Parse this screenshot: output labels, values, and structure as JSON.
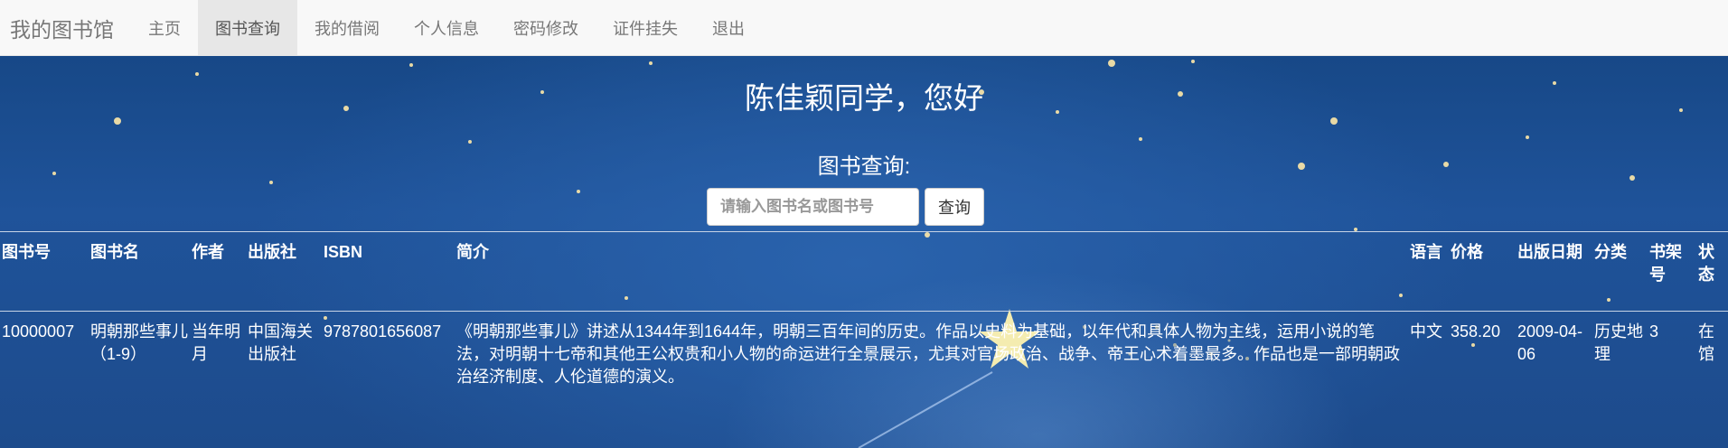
{
  "navbar": {
    "brand": "我的图书馆",
    "items": [
      {
        "label": "主页",
        "active": false
      },
      {
        "label": "图书查询",
        "active": true
      },
      {
        "label": "我的借阅",
        "active": false
      },
      {
        "label": "个人信息",
        "active": false
      },
      {
        "label": "密码修改",
        "active": false
      },
      {
        "label": "证件挂失",
        "active": false
      },
      {
        "label": "退出",
        "active": false
      }
    ]
  },
  "greeting": "陈佳颖同学，您好",
  "search": {
    "label": "图书查询:",
    "placeholder": "请输入图书名或图书号",
    "value": "",
    "button": "查询"
  },
  "table": {
    "headers": [
      "图书号",
      "图书名",
      "作者",
      "出版社",
      "ISBN",
      "简介",
      "语言",
      "价格",
      "出版日期",
      "分类",
      "书架号",
      "状态"
    ],
    "rows": [
      {
        "book_id": "10000007",
        "title": "明朝那些事儿（1-9）",
        "author": "当年明月",
        "publisher": "中国海关出版社",
        "isbn": "9787801656087",
        "summary": "《明朝那些事儿》讲述从1344年到1644年，明朝三百年间的历史。作品以史料为基础，以年代和具体人物为主线，运用小说的笔法，对明朝十七帝和其他王公权贵和小人物的命运进行全景展示，尤其对官场政治、战争、帝王心术着墨最多。作品也是一部明朝政治经济制度、人伦道德的演义。",
        "language": "中文",
        "price": "358.20",
        "pub_date": "2009-04-06",
        "category": "历史地理",
        "shelf": "3",
        "status": "在馆"
      }
    ]
  },
  "colors": {
    "navbar_bg": "#f8f8f8",
    "nav_text": "#777777",
    "hero_bg": "#1f539a",
    "table_text": "#ffffff"
  }
}
